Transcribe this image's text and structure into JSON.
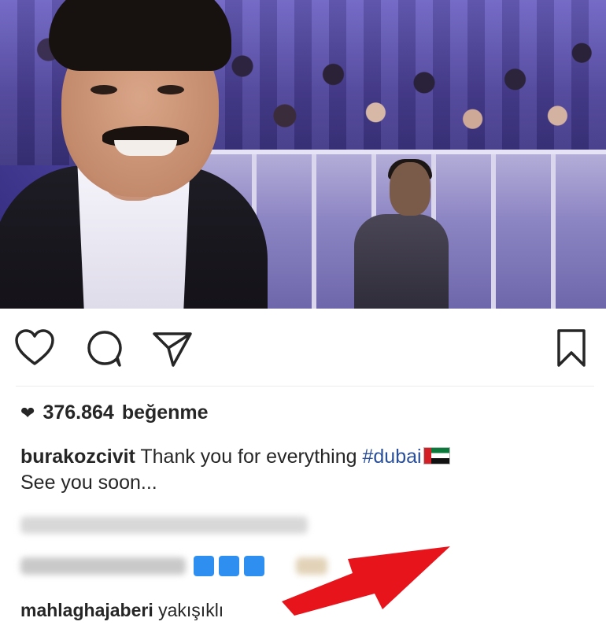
{
  "post": {
    "likes_count": "376.864",
    "likes_label": "beğenme",
    "caption_user": "burakozcivit",
    "caption_text": "Thank you for everything",
    "caption_hashtag": "#dubai",
    "caption_line2": "See you soon...",
    "comments": [
      {
        "user": "mahlaghajaberi",
        "text": "yakışıklı"
      }
    ]
  },
  "icons": {
    "like": "heart-outline-icon",
    "comment": "comment-bubble-icon",
    "share": "paper-plane-icon",
    "save": "bookmark-icon",
    "likes_heart": "heart-filled-icon",
    "flag": "uae-flag-emoji",
    "annotation": "red-arrow"
  },
  "colors": {
    "text": "#262626",
    "hashtag": "#2a4f9b",
    "arrow": "#e8141c",
    "blurred_hearts": "#2f8ff0"
  }
}
